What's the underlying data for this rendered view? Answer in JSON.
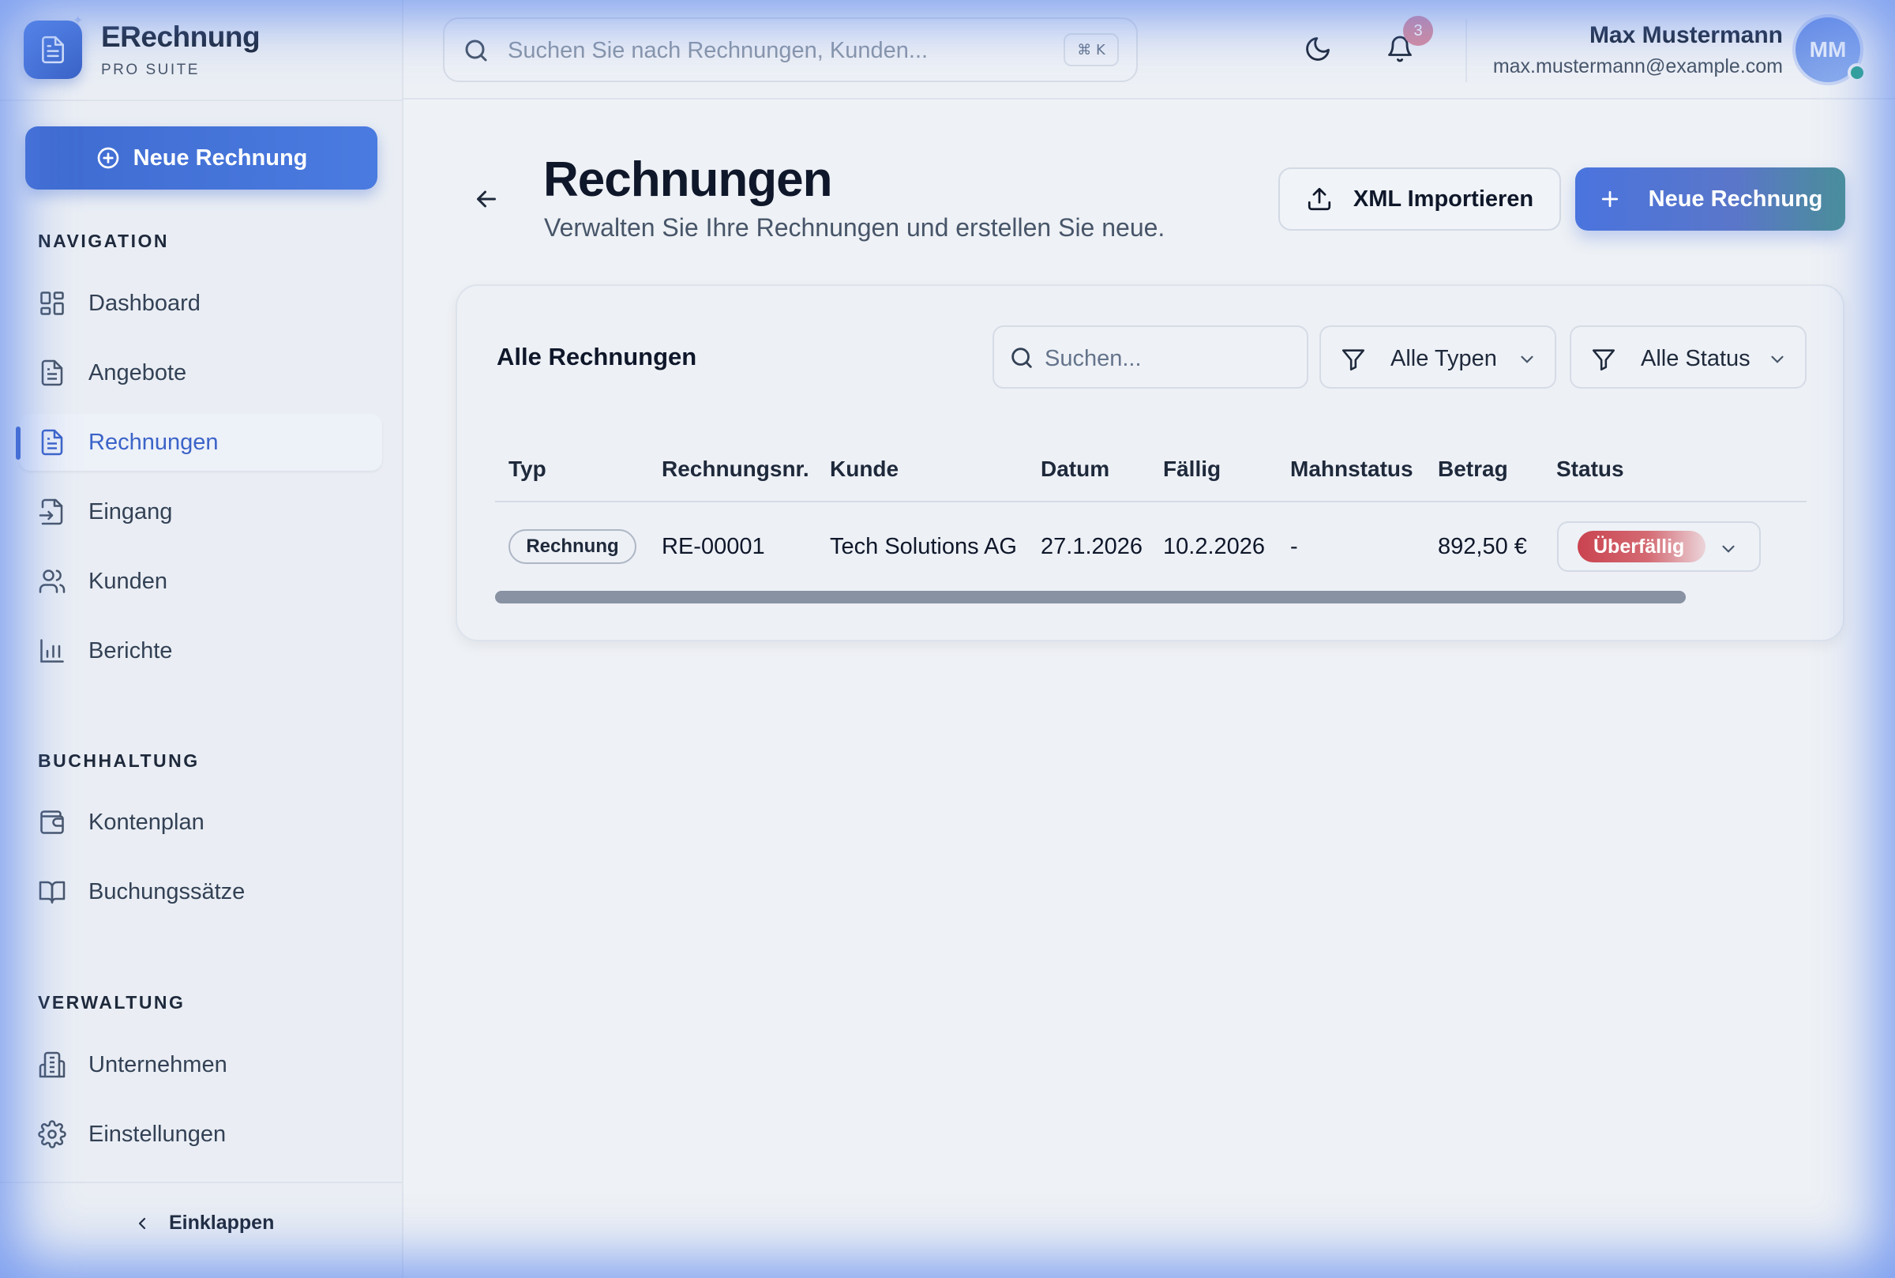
{
  "brand": {
    "name": "ERechnung",
    "subtitle": "PRO SUITE"
  },
  "sidebar": {
    "new_invoice_label": "Neue Rechnung",
    "sections": {
      "navigation": "NAVIGATION",
      "buchhaltung": "BUCHHALTUNG",
      "verwaltung": "VERWALTUNG"
    },
    "items": [
      {
        "label": "Dashboard",
        "icon": "layout-grid-icon",
        "active": false
      },
      {
        "label": "Angebote",
        "icon": "file-text-icon",
        "active": false
      },
      {
        "label": "Rechnungen",
        "icon": "file-text-icon",
        "active": true
      },
      {
        "label": "Eingang",
        "icon": "file-input-icon",
        "active": false
      },
      {
        "label": "Kunden",
        "icon": "users-icon",
        "active": false
      },
      {
        "label": "Berichte",
        "icon": "bar-chart-icon",
        "active": false
      },
      {
        "label": "Kontenplan",
        "icon": "wallet-icon",
        "active": false
      },
      {
        "label": "Buchungssätze",
        "icon": "book-open-icon",
        "active": false
      },
      {
        "label": "Unternehmen",
        "icon": "building-icon",
        "active": false
      },
      {
        "label": "Einstellungen",
        "icon": "gear-icon",
        "active": false
      }
    ],
    "collapse_label": "Einklappen"
  },
  "header": {
    "search_placeholder": "Suchen Sie nach Rechnungen, Kunden...",
    "shortcut": "⌘ K",
    "notification_count": "3",
    "user": {
      "name": "Max Mustermann",
      "email": "max.mustermann@example.com",
      "initials": "MM"
    }
  },
  "page": {
    "title": "Rechnungen",
    "subtitle": "Verwalten Sie Ihre Rechnungen und erstellen Sie neue.",
    "import_label": "XML Importieren",
    "new_label": "Neue Rechnung"
  },
  "card": {
    "title": "Alle Rechnungen",
    "search_placeholder": "Suchen...",
    "filter_type": "Alle Typen",
    "filter_status": "Alle Status",
    "columns": [
      "Typ",
      "Rechnungsnr.",
      "Kunde",
      "Datum",
      "Fällig",
      "Mahnstatus",
      "Betrag",
      "Status"
    ],
    "rows": [
      {
        "typ": "Rechnung",
        "nummer": "RE-00001",
        "kunde": "Tech Solutions AG",
        "datum": "27.1.2026",
        "faellig": "10.2.2026",
        "mahnstatus": "-",
        "betrag": "892,50 €",
        "status": "Überfällig"
      }
    ]
  },
  "colors": {
    "primary": "#3b63c8",
    "overdue": "#c9434f",
    "online": "#2ca58d"
  }
}
